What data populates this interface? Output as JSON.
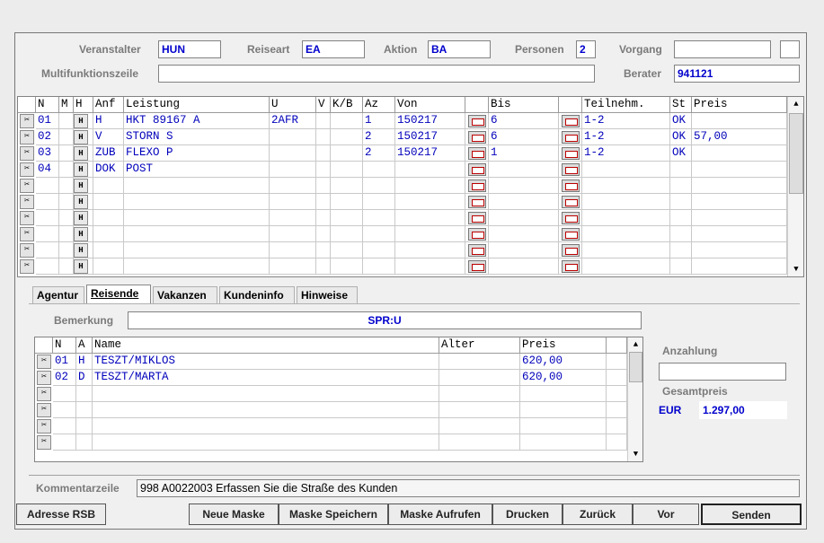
{
  "header": {
    "veranstalter": {
      "label": "Veranstalter",
      "value": "HUN"
    },
    "reiseart": {
      "label": "Reiseart",
      "value": "EA"
    },
    "aktion": {
      "label": "Aktion",
      "value": "BA"
    },
    "personen": {
      "label": "Personen",
      "value": "2"
    },
    "vorgang": {
      "label": "Vorgang",
      "value": ""
    },
    "multifunktion": {
      "label": "Multifunktionszeile",
      "value": ""
    },
    "berater": {
      "label": "Berater",
      "value": "941121"
    }
  },
  "leistungen": {
    "columns": [
      "N",
      "M",
      "H",
      "Anf",
      "Leistung",
      "U",
      "V",
      "K/B",
      "Az",
      "Von",
      "",
      "Bis",
      "",
      "Teilnehm.",
      "St",
      "Preis"
    ],
    "rows": [
      {
        "n": "01",
        "m": "",
        "h": "H",
        "anf": "H",
        "leistung": "HKT 89167 A",
        "u": "2AFR",
        "v": "",
        "kb": "",
        "az": "1",
        "von": "150217",
        "bis": "6",
        "teilnehm": "1-2",
        "st": "OK",
        "preis": ""
      },
      {
        "n": "02",
        "m": "",
        "h": "H",
        "anf": "V",
        "leistung": "STORN S",
        "u": "",
        "v": "",
        "kb": "",
        "az": "2",
        "von": "150217",
        "bis": "6",
        "teilnehm": "1-2",
        "st": "OK",
        "preis": "57,00"
      },
      {
        "n": "03",
        "m": "",
        "h": "H",
        "anf": "ZUB",
        "leistung": "FLEXO P",
        "u": "",
        "v": "",
        "kb": "",
        "az": "2",
        "von": "150217",
        "bis": "1",
        "teilnehm": "1-2",
        "st": "OK",
        "preis": ""
      },
      {
        "n": "04",
        "m": "",
        "h": "H",
        "anf": "DOK",
        "leistung": "POST",
        "u": "",
        "v": "",
        "kb": "",
        "az": "",
        "von": "",
        "bis": "",
        "teilnehm": "",
        "st": "",
        "preis": ""
      },
      {
        "n": "",
        "m": "",
        "h": "H",
        "anf": "",
        "leistung": "",
        "u": "",
        "v": "",
        "kb": "",
        "az": "",
        "von": "",
        "bis": "",
        "teilnehm": "",
        "st": "",
        "preis": ""
      },
      {
        "n": "",
        "m": "",
        "h": "H",
        "anf": "",
        "leistung": "",
        "u": "",
        "v": "",
        "kb": "",
        "az": "",
        "von": "",
        "bis": "",
        "teilnehm": "",
        "st": "",
        "preis": ""
      },
      {
        "n": "",
        "m": "",
        "h": "H",
        "anf": "",
        "leistung": "",
        "u": "",
        "v": "",
        "kb": "",
        "az": "",
        "von": "",
        "bis": "",
        "teilnehm": "",
        "st": "",
        "preis": ""
      },
      {
        "n": "",
        "m": "",
        "h": "H",
        "anf": "",
        "leistung": "",
        "u": "",
        "v": "",
        "kb": "",
        "az": "",
        "von": "",
        "bis": "",
        "teilnehm": "",
        "st": "",
        "preis": ""
      },
      {
        "n": "",
        "m": "",
        "h": "H",
        "anf": "",
        "leistung": "",
        "u": "",
        "v": "",
        "kb": "",
        "az": "",
        "von": "",
        "bis": "",
        "teilnehm": "",
        "st": "",
        "preis": ""
      },
      {
        "n": "",
        "m": "",
        "h": "H",
        "anf": "",
        "leistung": "",
        "u": "",
        "v": "",
        "kb": "",
        "az": "",
        "von": "",
        "bis": "",
        "teilnehm": "",
        "st": "",
        "preis": ""
      }
    ]
  },
  "tabs": [
    "Agentur",
    "Reisende",
    "Vakanzen",
    "Kundeninfo",
    "Hinweise"
  ],
  "active_tab": "Reisende",
  "bemerkung": {
    "label": "Bemerkung",
    "value": "SPR:U"
  },
  "reisende": {
    "columns": [
      "N",
      "A",
      "Name",
      "Alter",
      "Preis"
    ],
    "rows": [
      {
        "n": "01",
        "a": "H",
        "name": "TESZT/MIKLOS",
        "alter": "",
        "preis": "620,00"
      },
      {
        "n": "02",
        "a": "D",
        "name": "TESZT/MARTA",
        "alter": "",
        "preis": "620,00"
      },
      {
        "n": "",
        "a": "",
        "name": "",
        "alter": "",
        "preis": ""
      },
      {
        "n": "",
        "a": "",
        "name": "",
        "alter": "",
        "preis": ""
      },
      {
        "n": "",
        "a": "",
        "name": "",
        "alter": "",
        "preis": ""
      },
      {
        "n": "",
        "a": "",
        "name": "",
        "alter": "",
        "preis": ""
      }
    ]
  },
  "anzahlung": {
    "label": "Anzahlung",
    "value": ""
  },
  "gesamtpreis": {
    "label": "Gesamtpreis",
    "currency": "EUR",
    "value": "1.297,00"
  },
  "kommentar": {
    "label": "Kommentarzeile",
    "value": "998 A0022003 Erfassen Sie die Straße des Kunden"
  },
  "buttons": {
    "adresse": "Adresse RSB",
    "neue_maske": "Neue Maske",
    "maske_speichern": "Maske Speichern",
    "maske_aufrufen": "Maske Aufrufen",
    "drucken": "Drucken",
    "zurueck": "Zurück",
    "vor": "Vor",
    "senden": "Senden"
  },
  "icons": {
    "row_action": "scissors-icon",
    "calendar": "calendar-icon"
  }
}
